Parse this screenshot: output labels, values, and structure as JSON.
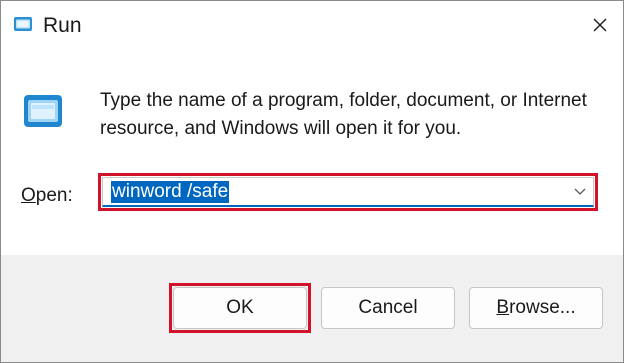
{
  "window": {
    "title": "Run",
    "close_glyph": "✕"
  },
  "content": {
    "description": "Type the name of a program, folder, document, or Internet resource, and Windows will open it for you.",
    "open_label_mnemonic": "O",
    "open_label_rest": "pen:",
    "combo_value": "winword /safe"
  },
  "buttons": {
    "ok": "OK",
    "cancel": "Cancel",
    "browse_mnemonic": "B",
    "browse_rest": "rowse..."
  },
  "icons": {
    "title_icon": "run-app-icon",
    "app_icon": "run-app-icon",
    "close": "close-icon",
    "dropdown": "chevron-down-icon"
  },
  "colors": {
    "highlight": "#d0132b",
    "selection": "#0067c0"
  }
}
